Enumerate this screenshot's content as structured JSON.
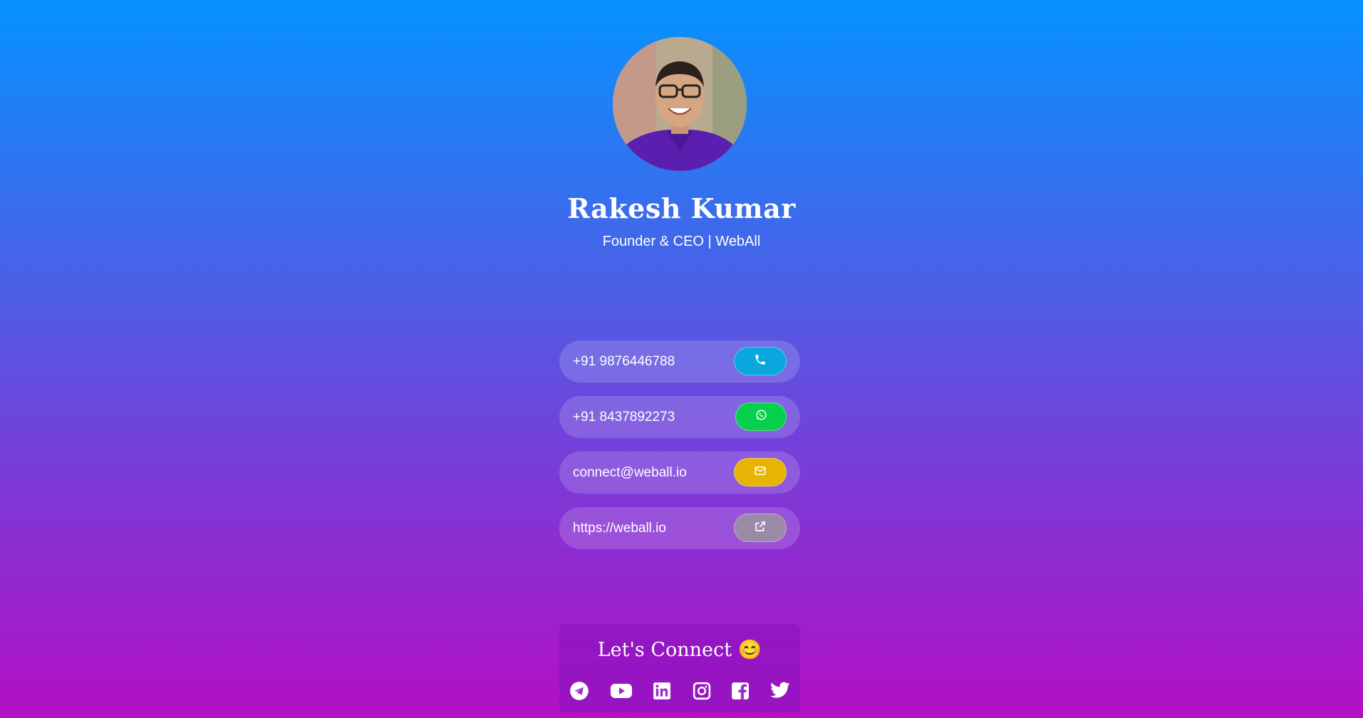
{
  "profile": {
    "name": "Rakesh Kumar",
    "title": "Founder & CEO | WebAll"
  },
  "contacts": [
    {
      "value": "+91 9876446788",
      "icon": "phone-icon",
      "color": "#0aa6de"
    },
    {
      "value": "+91 8437892273",
      "icon": "whatsapp-icon",
      "color": "#08d04f"
    },
    {
      "value": "connect@weball.io",
      "icon": "mail-icon",
      "color": "#e8b404"
    },
    {
      "value": "https://weball.io",
      "icon": "external-link-icon",
      "color": "#9a8aa8"
    }
  ],
  "connect": {
    "heading": "Let's Connect",
    "emoji": "😊",
    "socials": [
      "telegram-icon",
      "youtube-icon",
      "linkedin-icon",
      "instagram-icon",
      "facebook-icon",
      "twitter-icon"
    ]
  }
}
